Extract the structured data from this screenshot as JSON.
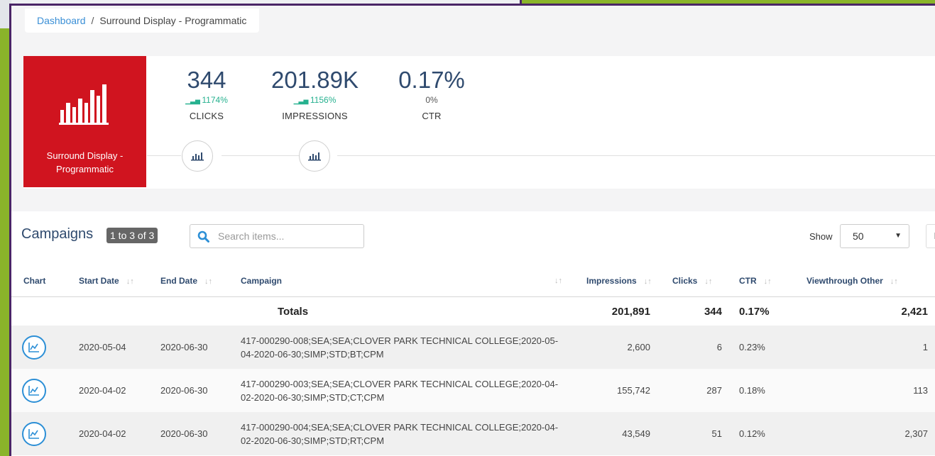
{
  "breadcrumb": {
    "home": "Dashboard",
    "separator": "/",
    "current": "Surround Display - Programmatic"
  },
  "tile": {
    "name": "Surround Display - Programmatic",
    "icon": "bar-chart-icon",
    "color": "#d0141f"
  },
  "stats": {
    "clicks": {
      "value": "344",
      "change": "1174%",
      "label": "CLICKS"
    },
    "impressions": {
      "value": "201.89K",
      "change": "1156%",
      "label": "IMPRESSIONS"
    },
    "ctr": {
      "value": "0.17%",
      "change": "0%",
      "label": "CTR"
    }
  },
  "campaigns": {
    "title": "Campaigns",
    "count": "1 to 3 of 3",
    "search_placeholder": "Search items...",
    "show_label": "Show",
    "page_size": "50",
    "pager_stub": "P",
    "columns": [
      "Chart",
      "Start Date",
      "End Date",
      "Campaign",
      "Impressions",
      "Clicks",
      "CTR",
      "Viewthrough Other"
    ],
    "totals": {
      "label": "Totals",
      "impressions": "201,891",
      "clicks": "344",
      "ctr": "0.17%",
      "viewthrough": "2,421"
    },
    "rows": [
      {
        "start": "2020-05-04",
        "end": "2020-06-30",
        "campaign": "417-000290-008;SEA;SEA;CLOVER PARK TECHNICAL COLLEGE;2020-05-04-2020-06-30;SIMP;STD;BT;CPM",
        "impressions": "2,600",
        "clicks": "6",
        "ctr": "0.23%",
        "viewthrough": "1"
      },
      {
        "start": "2020-04-02",
        "end": "2020-06-30",
        "campaign": "417-000290-003;SEA;SEA;CLOVER PARK TECHNICAL COLLEGE;2020-04-02-2020-06-30;SIMP;STD;CT;CPM",
        "impressions": "155,742",
        "clicks": "287",
        "ctr": "0.18%",
        "viewthrough": "113"
      },
      {
        "start": "2020-04-02",
        "end": "2020-06-30",
        "campaign": "417-000290-004;SEA;SEA;CLOVER PARK TECHNICAL COLLEGE;2020-04-02-2020-06-30;SIMP;STD;RT;CPM",
        "impressions": "43,549",
        "clicks": "51",
        "ctr": "0.12%",
        "viewthrough": "2,307"
      }
    ]
  },
  "colors": {
    "accent": "#2c8fd6",
    "positive": "#26b18f",
    "heading": "#2f4a6e",
    "frame": "#4a2566",
    "backdrop": "#8ab42a"
  }
}
